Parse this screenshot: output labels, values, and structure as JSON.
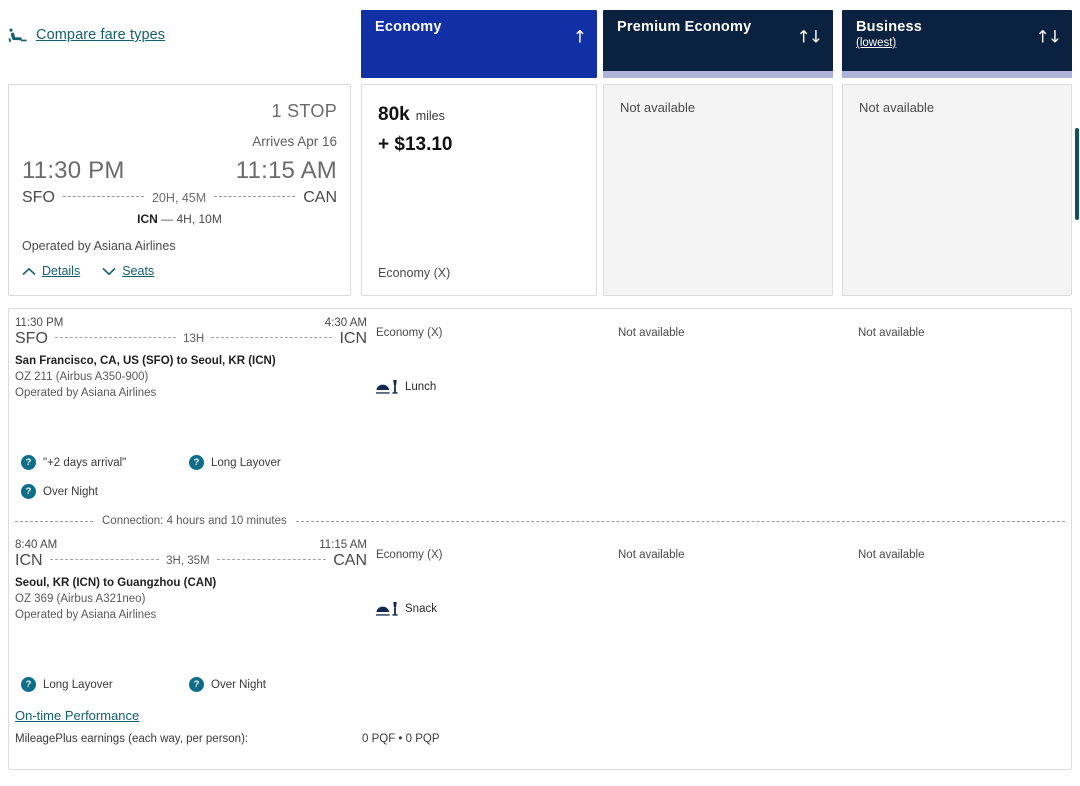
{
  "toolbar": {
    "compare_label": "Compare fare types",
    "seat_icon": "seat-recline-icon"
  },
  "fare_columns": [
    {
      "id": "economy",
      "title": "Economy",
      "sub": "",
      "sort_icon": "↑",
      "selected": true,
      "header_color": "#1130a5"
    },
    {
      "id": "premium",
      "title": "Premium Economy",
      "sub": "",
      "sort_icon": "↑↓",
      "selected": false,
      "header_color": "#0a2240"
    },
    {
      "id": "business",
      "title": "Business",
      "sub": "(lowest)",
      "sort_icon": "↑↓",
      "selected": false,
      "header_color": "#0a2240"
    }
  ],
  "summary": {
    "stops": "1 STOP",
    "arrives": "Arrives Apr 16",
    "depart_time": "11:30 PM",
    "arrive_time": "11:15 AM",
    "origin": "SFO",
    "destination": "CAN",
    "total_duration": "20H, 45M",
    "connection_code": "ICN",
    "connection_dur": "— 4H, 10M",
    "operated_by": "Operated by Asiana Airlines",
    "details_label": "Details",
    "seats_label": "Seats"
  },
  "fares": {
    "economy": {
      "miles": "80k",
      "miles_unit": "miles",
      "cash": "+ $13.10",
      "cabin": "Economy (X)"
    },
    "premium": {
      "status": "Not available"
    },
    "business": {
      "status": "Not available"
    }
  },
  "segments": [
    {
      "depart_time": "11:30 PM",
      "arrive_time": "4:30 AM",
      "origin": "SFO",
      "destination": "ICN",
      "duration": "13H",
      "route": "San Francisco, CA, US (SFO) to Seoul, KR (ICN)",
      "flight": "OZ 211 (Airbus A350-900)",
      "operated_by": "Operated by Asiana Airlines",
      "cabin_economy": "Economy (X)",
      "cabin_premium": "Not available",
      "cabin_business": "Not available",
      "meal": "Lunch",
      "meal_icon": "meal-tray-icon",
      "badges": [
        "\"+2 days arrival\"",
        "Long Layover",
        "Over Night"
      ]
    },
    {
      "depart_time": "8:40 AM",
      "arrive_time": "11:15 AM",
      "origin": "ICN",
      "destination": "CAN",
      "duration": "3H, 35M",
      "route": "Seoul, KR (ICN) to Guangzhou (CAN)",
      "flight": "OZ 369 (Airbus A321neo)",
      "operated_by": "Operated by Asiana Airlines",
      "cabin_economy": "Economy (X)",
      "cabin_premium": "Not available",
      "cabin_business": "Not available",
      "meal": "Snack",
      "meal_icon": "meal-tray-icon",
      "badges": [
        "Long Layover",
        "Over Night"
      ]
    }
  ],
  "connection": {
    "text": "Connection: 4 hours and 10 minutes"
  },
  "footer": {
    "otp_link": "On-time Performance",
    "mileage_label": "MileagePlus earnings (each way, per person):",
    "mileage_value": "0 PQF • 0 PQP"
  }
}
